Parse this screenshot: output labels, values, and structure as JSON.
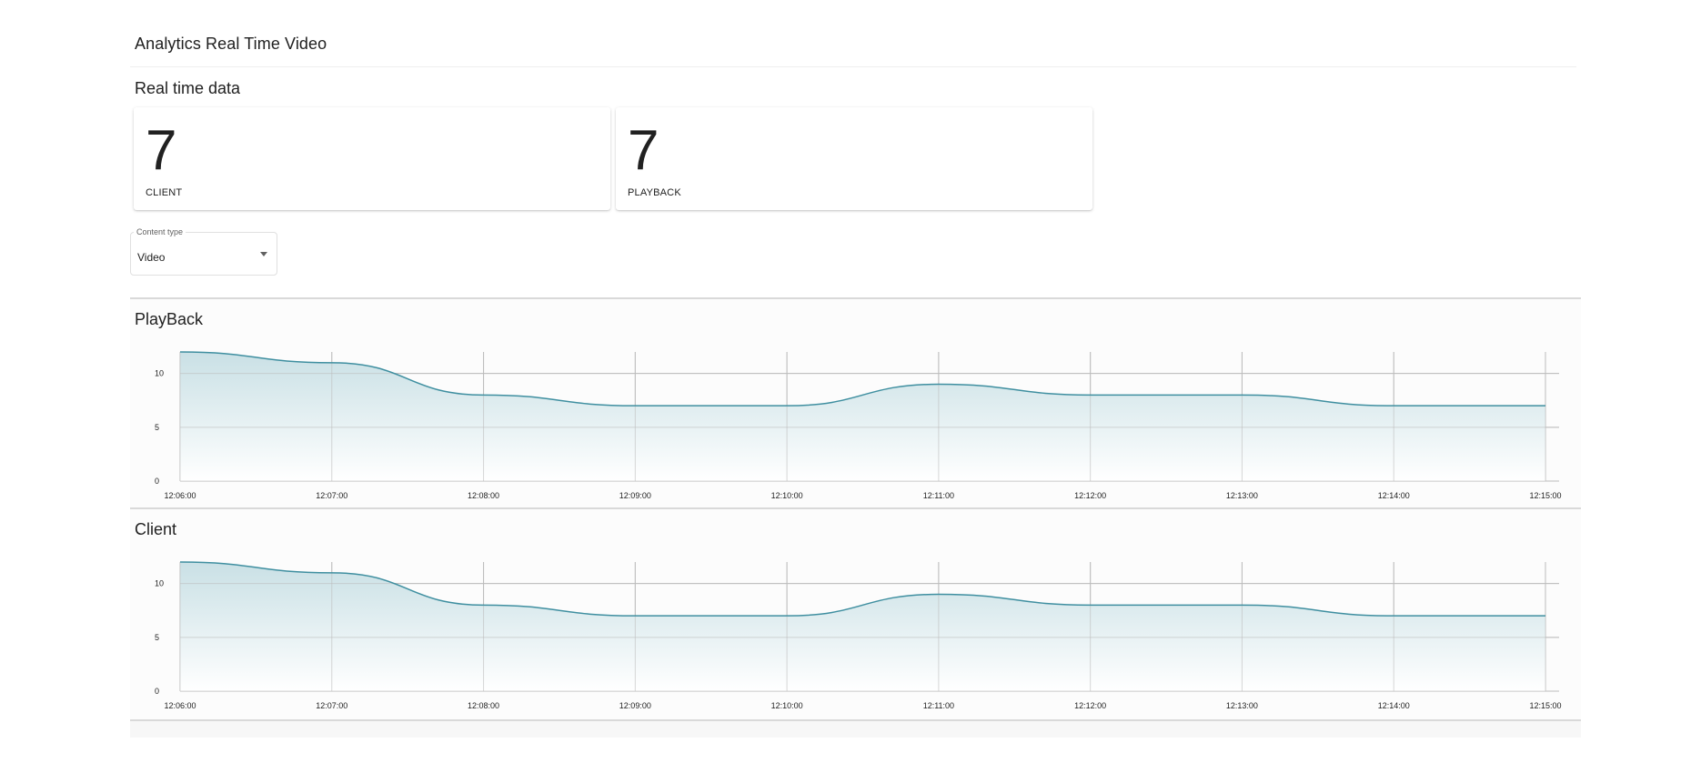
{
  "header": {
    "title": "Analytics Real Time Video"
  },
  "realtime": {
    "section_title": "Real time data",
    "cards": [
      {
        "value": "7",
        "label": "CLIENT"
      },
      {
        "value": "7",
        "label": "PLAYBACK"
      }
    ]
  },
  "filter": {
    "label": "Content type",
    "value": "Video"
  },
  "colors": {
    "line": "#3f8fa0",
    "area_top": "#c9e0e5",
    "area_bottom": "#ffffff",
    "grid": "#bdbdbd"
  },
  "chart_data": [
    {
      "type": "area",
      "title": "PlayBack",
      "x": [
        "12:06:00",
        "12:07:00",
        "12:08:00",
        "12:09:00",
        "12:10:00",
        "12:11:00",
        "12:12:00",
        "12:13:00",
        "12:14:00",
        "12:15:00"
      ],
      "y": [
        12,
        11,
        8,
        7,
        7,
        9,
        8,
        8,
        7,
        7
      ],
      "yticks": [
        0,
        5,
        10
      ],
      "ylim": [
        0,
        12
      ],
      "grid": true
    },
    {
      "type": "area",
      "title": "Client",
      "x": [
        "12:06:00",
        "12:07:00",
        "12:08:00",
        "12:09:00",
        "12:10:00",
        "12:11:00",
        "12:12:00",
        "12:13:00",
        "12:14:00",
        "12:15:00"
      ],
      "y": [
        12,
        11,
        8,
        7,
        7,
        9,
        8,
        8,
        7,
        7
      ],
      "yticks": [
        0,
        5,
        10
      ],
      "ylim": [
        0,
        12
      ],
      "grid": true
    }
  ]
}
